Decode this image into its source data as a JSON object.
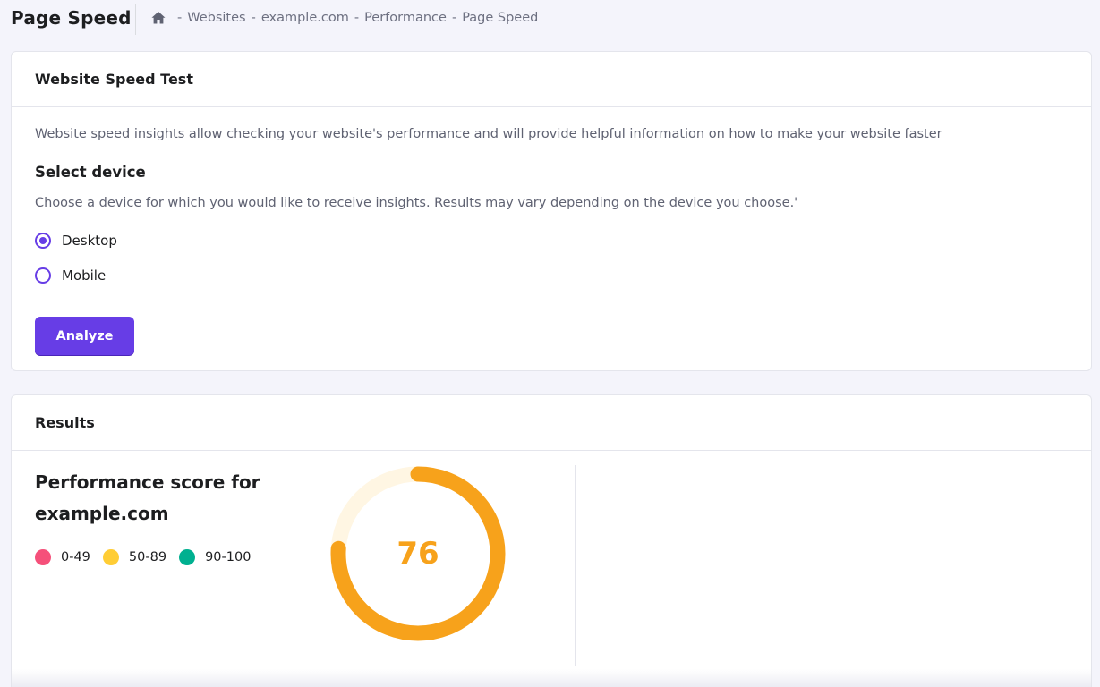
{
  "header": {
    "page_title": "Page Speed",
    "breadcrumb": {
      "home_icon": "home-icon",
      "separator": "-",
      "items": [
        "Websites",
        "example.com",
        "Performance",
        "Page Speed"
      ]
    }
  },
  "speed_test": {
    "title": "Website Speed Test",
    "description": "Website speed insights allow checking your website's performance and will provide helpful information on how to make your website faster",
    "select_title": "Select device",
    "select_description": "Choose a device for which you would like to receive insights. Results may vary depending on the device you choose.'",
    "devices": [
      {
        "label": "Desktop",
        "selected": true
      },
      {
        "label": "Mobile",
        "selected": false
      }
    ],
    "analyze_label": "Analyze"
  },
  "results": {
    "title": "Results",
    "performance_title": "Performance score for example.com",
    "legend": [
      {
        "label": "0-49",
        "color": "#f5507a"
      },
      {
        "label": "50-89",
        "color": "#ffcd35"
      },
      {
        "label": "90-100",
        "color": "#00b090"
      }
    ],
    "score": "76",
    "score_fraction": 0.76,
    "score_color": "#f7a21b",
    "track_color": "#fff6e3"
  },
  "colors": {
    "accent": "#673de6",
    "background": "#f4f4fb"
  }
}
